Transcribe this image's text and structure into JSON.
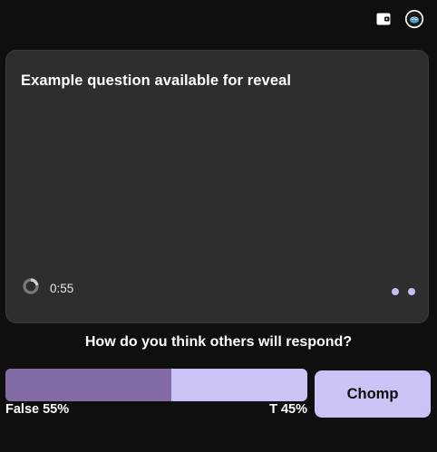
{
  "question": {
    "text": "Example question available for reveal",
    "timer": "0:55"
  },
  "prompt": "How do you think others will respond?",
  "response_bar": {
    "false_label": "False 55%",
    "true_label": "T 45%",
    "false_percent": 55,
    "true_percent": 45
  },
  "chomp_button": {
    "label": "Chomp"
  },
  "colors": {
    "background": "#0f0f0f",
    "card": "#2e2e2e",
    "accent": "#cbc3f5",
    "false_fill": "#836ca6"
  },
  "icons": {
    "wallet": "wallet-icon",
    "avatar": "avatar-icon",
    "timer": "timer-ring-icon"
  }
}
